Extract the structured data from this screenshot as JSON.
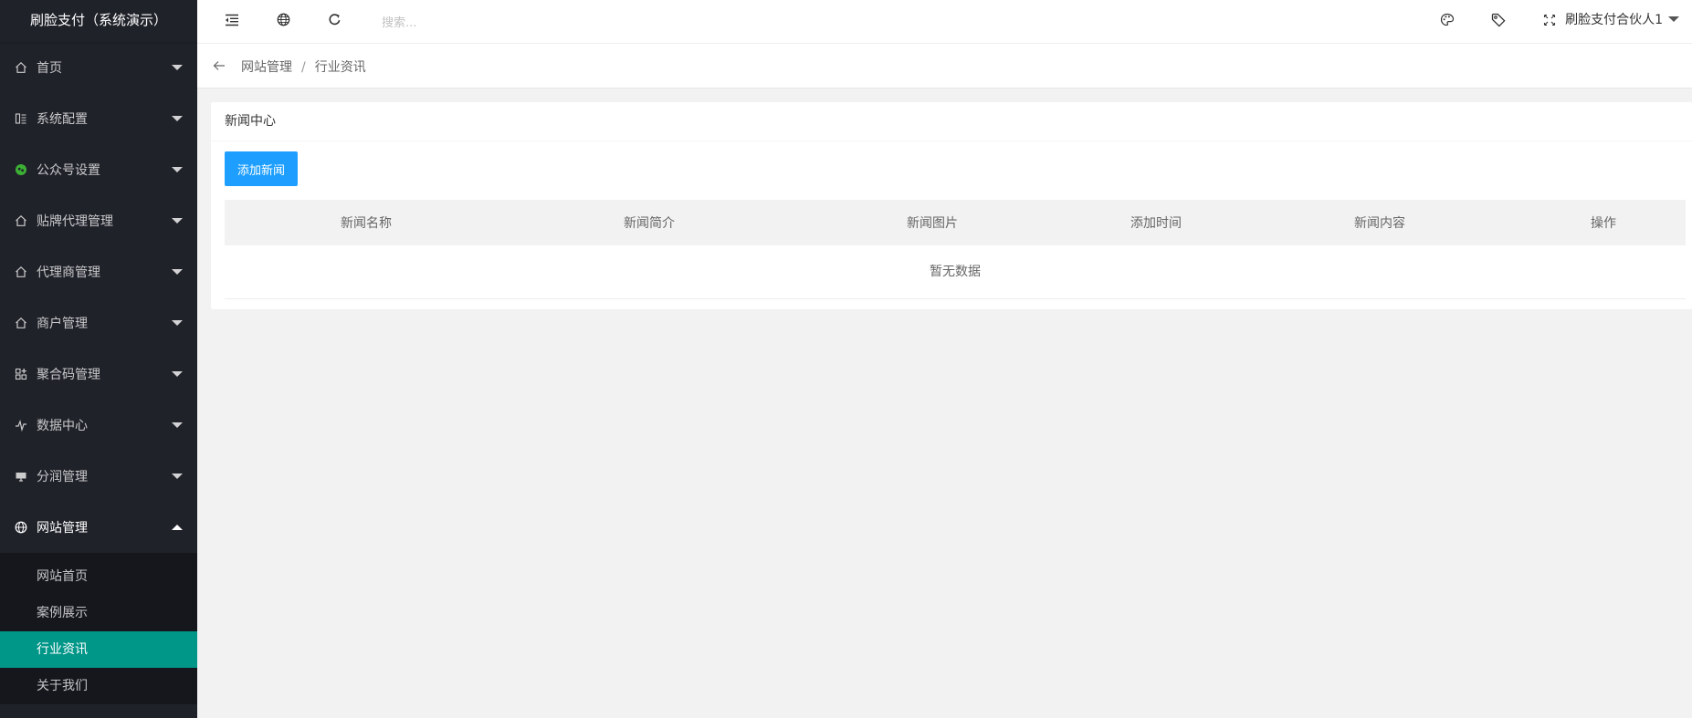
{
  "app": {
    "title": "刷脸支付（系统演示）"
  },
  "sidebar": {
    "items": [
      {
        "label": "首页",
        "icon": "home-icon"
      },
      {
        "label": "系统配置",
        "icon": "settings-icon"
      },
      {
        "label": "公众号设置",
        "icon": "wechat-icon"
      },
      {
        "label": "贴牌代理管理",
        "icon": "home-icon"
      },
      {
        "label": "代理商管理",
        "icon": "home-icon"
      },
      {
        "label": "商户管理",
        "icon": "home-icon"
      },
      {
        "label": "聚合码管理",
        "icon": "qrcode-icon"
      },
      {
        "label": "数据中心",
        "icon": "chart-icon"
      },
      {
        "label": "分润管理",
        "icon": "monitor-icon"
      },
      {
        "label": "网站管理",
        "icon": "website-icon"
      }
    ],
    "submenu": [
      {
        "label": "网站首页"
      },
      {
        "label": "案例展示"
      },
      {
        "label": "行业资讯"
      },
      {
        "label": "关于我们"
      }
    ],
    "accent": "#009688"
  },
  "header": {
    "search_placeholder": "搜索...",
    "user_name": "刷脸支付合伙人1"
  },
  "breadcrumb": {
    "parent": "网站管理",
    "current": "行业资讯"
  },
  "card": {
    "title": "新闻中心",
    "add_button": "添加新闻",
    "columns": [
      "新闻名称",
      "新闻简介",
      "新闻图片",
      "添加时间",
      "新闻内容",
      "操作"
    ],
    "empty_text": "暂无数据"
  },
  "colors": {
    "primary_button": "#1e9fff",
    "sidebar_bg": "#20222a"
  }
}
